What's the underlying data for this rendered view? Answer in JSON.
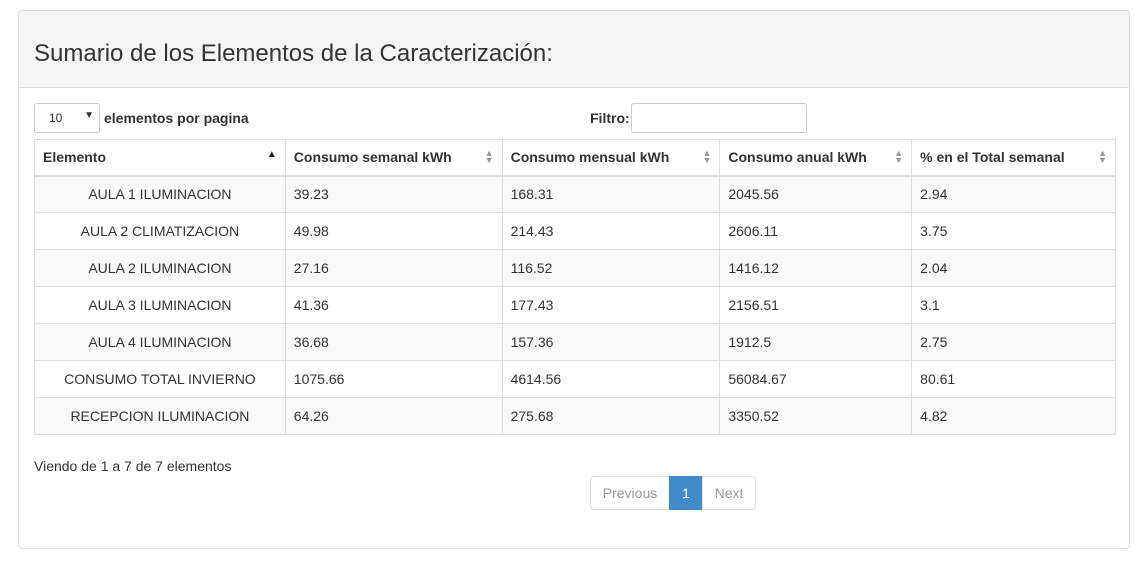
{
  "panel": {
    "title": "Sumario de los Elementos de la Caracterización:"
  },
  "length": {
    "selected": "10",
    "label": "elementos por pagina"
  },
  "filter": {
    "label": "Filtro:",
    "value": ""
  },
  "table": {
    "headers": [
      "Elemento",
      "Consumo semanal kWh",
      "Consumo mensual kWh",
      "Consumo anual kWh",
      "% en el Total semanal"
    ],
    "rows": [
      [
        "AULA 1 ILUMINACION",
        "39.23",
        "168.31",
        "2045.56",
        "2.94"
      ],
      [
        "AULA 2 CLIMATIZACION",
        "49.98",
        "214.43",
        "2606.11",
        "3.75"
      ],
      [
        "AULA 2 ILUMINACION",
        "27.16",
        "116.52",
        "1416.12",
        "2.04"
      ],
      [
        "AULA 3 ILUMINACION",
        "41.36",
        "177.43",
        "2156.51",
        "3.1"
      ],
      [
        "AULA 4 ILUMINACION",
        "36.68",
        "157.36",
        "1912.5",
        "2.75"
      ],
      [
        "CONSUMO TOTAL INVIERNO",
        "1075.66",
        "4614.56",
        "56084.67",
        "80.61"
      ],
      [
        "RECEPCION ILUMINACION",
        "64.26",
        "275.68",
        "3350.52",
        "4.82"
      ]
    ]
  },
  "info": "Viendo de 1 a 7 de 7 elementos",
  "pagination": {
    "previous": "Previous",
    "current": "1",
    "next": "Next"
  },
  "colors": {
    "accent": "#428bca",
    "heading_bg": "#f5f5f5",
    "stripe_bg": "#f9f9f9",
    "border": "#dddddd"
  },
  "icons": {
    "sort_asc": "sort-asc-icon",
    "sort_both": "sort-both-icon",
    "dropdown": "chevron-down-icon"
  }
}
